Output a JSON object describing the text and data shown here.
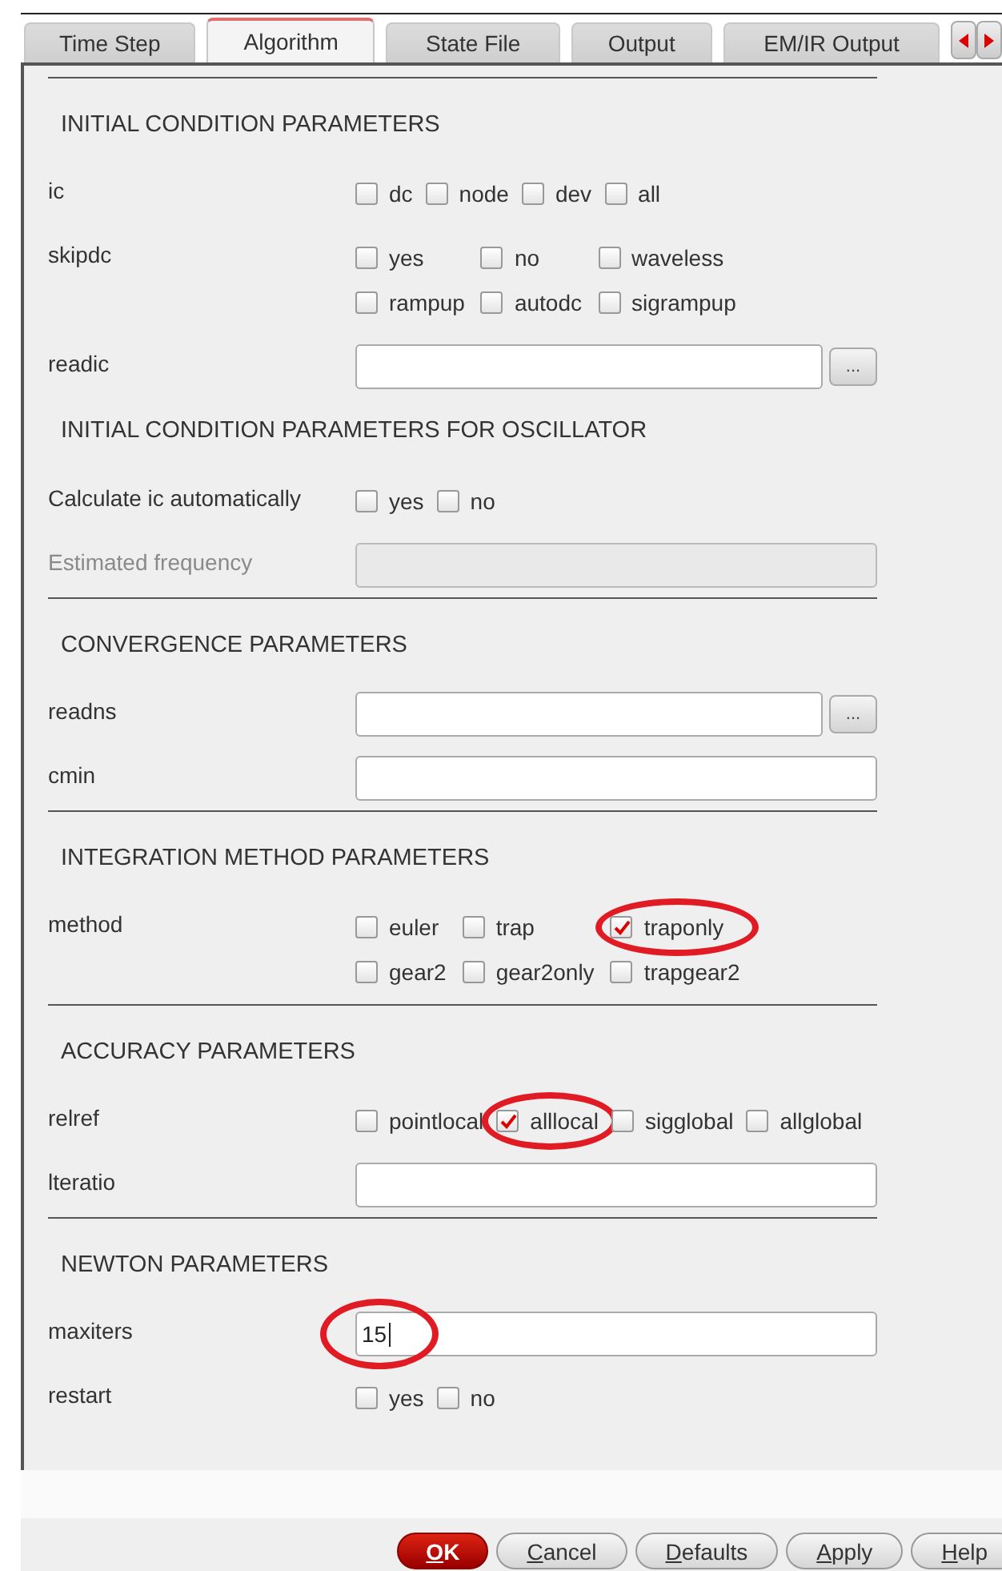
{
  "tabs": [
    {
      "label": "Time Step",
      "selected": false
    },
    {
      "label": "Algorithm",
      "selected": true
    },
    {
      "label": "State File",
      "selected": false
    },
    {
      "label": "Output",
      "selected": false
    },
    {
      "label": "EM/IR Output",
      "selected": false
    }
  ],
  "sections": [
    {
      "title": "INITIAL CONDITION PARAMETERS",
      "divider_above": true,
      "rows": [
        {
          "label": "ic",
          "kind": "flow",
          "disabled": false,
          "options": [
            {
              "label": "dc",
              "checked": false
            },
            {
              "label": "node",
              "checked": false
            },
            {
              "label": "dev",
              "checked": false
            },
            {
              "label": "all",
              "checked": false
            }
          ]
        },
        {
          "label": "skipdc",
          "kind": "grid",
          "disabled": false,
          "options": [
            {
              "label": "yes",
              "checked": false
            },
            {
              "label": "no",
              "checked": false
            },
            {
              "label": "waveless",
              "checked": false
            },
            {
              "label": "rampup",
              "checked": false
            },
            {
              "label": "autodc",
              "checked": false
            },
            {
              "label": "sigrampup",
              "checked": false
            }
          ]
        },
        {
          "label": "readic",
          "kind": "field",
          "disabled": false,
          "browse": "..."
        }
      ]
    },
    {
      "title": "INITIAL CONDITION PARAMETERS FOR OSCILLATOR",
      "divider_above": false,
      "rows": [
        {
          "label": "Calculate ic automatically",
          "kind": "flow",
          "disabled": false,
          "options": [
            {
              "label": "yes",
              "checked": false
            },
            {
              "label": "no",
              "checked": false
            }
          ]
        },
        {
          "label": "Estimated frequency",
          "kind": "field",
          "disabled": true
        }
      ]
    },
    {
      "title": "CONVERGENCE PARAMETERS",
      "divider_above": true,
      "rows": [
        {
          "label": "readns",
          "kind": "field",
          "disabled": false,
          "browse": "..."
        },
        {
          "label": "cmin",
          "kind": "field",
          "disabled": false
        }
      ]
    },
    {
      "title": "INTEGRATION METHOD PARAMETERS",
      "divider_above": true,
      "rows": [
        {
          "label": "method",
          "kind": "grid",
          "disabled": false,
          "options": [
            {
              "label": "euler",
              "checked": false
            },
            {
              "label": "trap",
              "checked": false
            },
            {
              "label": "traponly",
              "checked": true,
              "highlighted": true
            },
            {
              "label": "gear2",
              "checked": false
            },
            {
              "label": "gear2only",
              "checked": false
            },
            {
              "label": "trapgear2",
              "checked": false
            }
          ]
        }
      ]
    },
    {
      "title": "ACCURACY PARAMETERS",
      "divider_above": true,
      "rows": [
        {
          "label": "relref",
          "kind": "flow",
          "disabled": false,
          "options": [
            {
              "label": "pointlocal",
              "checked": false
            },
            {
              "label": "alllocal",
              "checked": true,
              "highlighted": true
            },
            {
              "label": "sigglobal",
              "checked": false
            },
            {
              "label": "allglobal",
              "checked": false
            }
          ]
        },
        {
          "label": "lteratio",
          "kind": "field",
          "disabled": false
        }
      ]
    },
    {
      "title": "NEWTON PARAMETERS",
      "divider_above": true,
      "rows": [
        {
          "label": "maxiters",
          "kind": "field",
          "disabled": false,
          "value": "15",
          "focused": true,
          "highlighted": true
        },
        {
          "label": "restart",
          "kind": "flow",
          "disabled": false,
          "options": [
            {
              "label": "yes",
              "checked": false
            },
            {
              "label": "no",
              "checked": false
            }
          ]
        }
      ]
    }
  ],
  "buttons": [
    {
      "mnemonic": "O",
      "rest": "K",
      "primary": true
    },
    {
      "mnemonic": "C",
      "rest": "ancel",
      "primary": false
    },
    {
      "mnemonic": "D",
      "rest": "efaults",
      "primary": false
    },
    {
      "mnemonic": "A",
      "rest": "pply",
      "primary": false
    },
    {
      "mnemonic": "H",
      "rest": "elp",
      "primary": false
    }
  ]
}
